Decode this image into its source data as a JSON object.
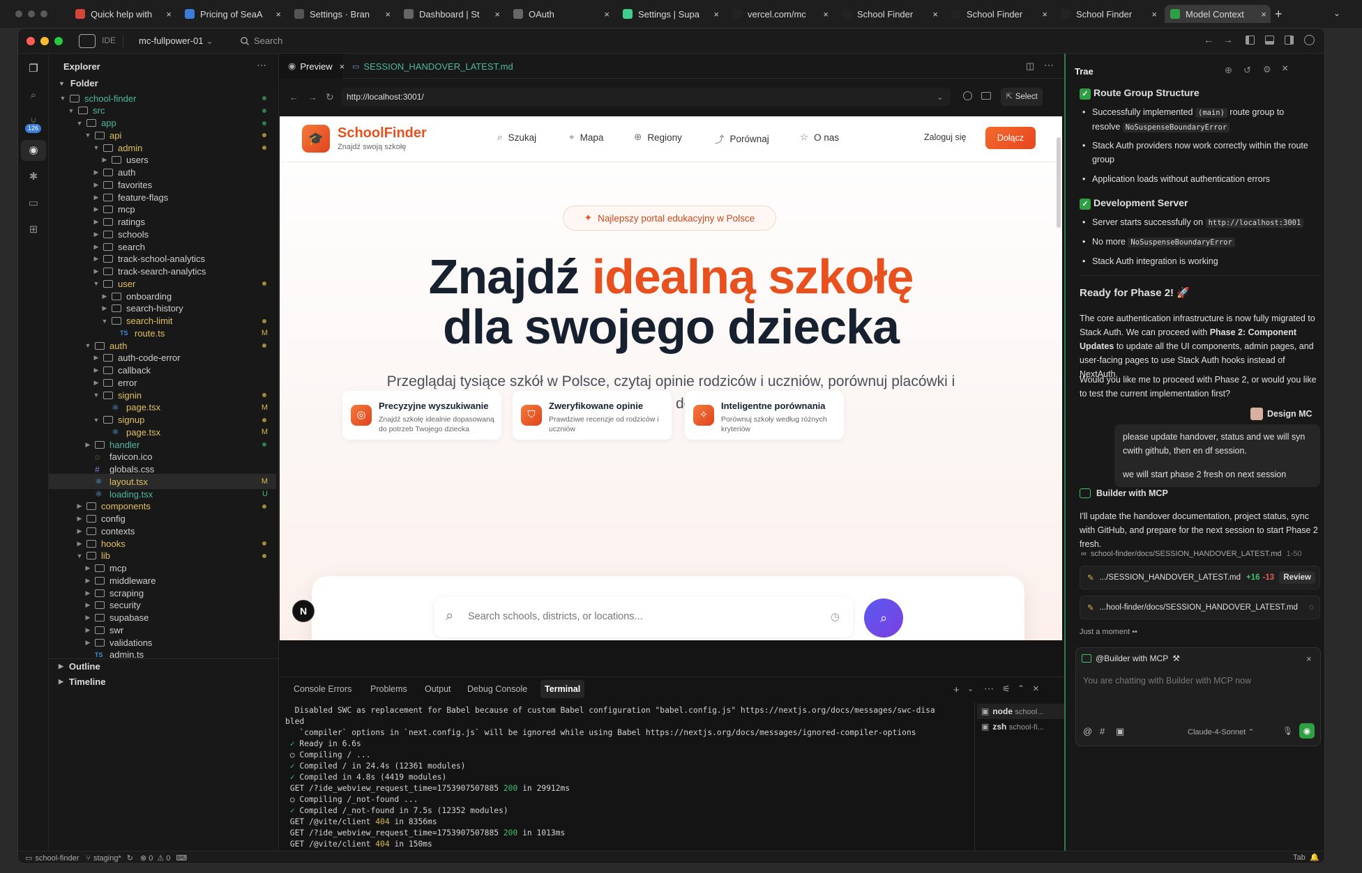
{
  "browser_tabs": [
    {
      "label": "Quick help with",
      "icon": "gmail-icon"
    },
    {
      "label": "Pricing of SeaA",
      "icon": "globe-icon"
    },
    {
      "label": "Settings · Bran",
      "icon": "github-icon"
    },
    {
      "label": "Dashboard | St",
      "icon": "stack-icon"
    },
    {
      "label": "OAuth",
      "icon": "stack-icon"
    },
    {
      "label": "Settings | Supa",
      "icon": "supabase-icon"
    },
    {
      "label": "vercel.com/mc",
      "icon": "vercel-icon"
    },
    {
      "label": "School Finder",
      "icon": "vercel-icon"
    },
    {
      "label": "School Finder",
      "icon": "vercel-icon"
    },
    {
      "label": "School Finder",
      "icon": "vercel-icon"
    },
    {
      "label": "Model Context",
      "icon": "mcp-icon"
    }
  ],
  "titlebar": {
    "ide_label": "IDE",
    "project": "mc-fullpower-01",
    "search_placeholder": "Search"
  },
  "activity": {
    "badge": "126"
  },
  "explorer": {
    "title": "Explorer",
    "folder_label": "Folder",
    "tree": [
      {
        "label": "school-finder",
        "depth": 0,
        "type": "folder",
        "open": true,
        "color": "#4fb8a0",
        "dot": "#2e7d4f"
      },
      {
        "label": "src",
        "depth": 1,
        "type": "folder",
        "open": true,
        "color": "#4fb8a0",
        "dot": "#2e7d4f"
      },
      {
        "label": "app",
        "depth": 2,
        "type": "folder",
        "open": true,
        "color": "#4fb8a0",
        "dot": "#2e7d4f"
      },
      {
        "label": "api",
        "depth": 3,
        "type": "folder",
        "open": true,
        "color": "#e0c060",
        "dot": "#a08a3a"
      },
      {
        "label": "admin",
        "depth": 4,
        "type": "folder",
        "open": true,
        "color": "#e0c060",
        "dot": "#a08a3a"
      },
      {
        "label": "users",
        "depth": 5,
        "type": "folder",
        "open": false,
        "color": "#cfcfcf"
      },
      {
        "label": "auth",
        "depth": 4,
        "type": "folder",
        "open": false,
        "color": "#cfcfcf"
      },
      {
        "label": "favorites",
        "depth": 4,
        "type": "folder",
        "open": false,
        "color": "#cfcfcf"
      },
      {
        "label": "feature-flags",
        "depth": 4,
        "type": "folder",
        "open": false,
        "color": "#cfcfcf"
      },
      {
        "label": "mcp",
        "depth": 4,
        "type": "folder",
        "open": false,
        "color": "#cfcfcf"
      },
      {
        "label": "ratings",
        "depth": 4,
        "type": "folder",
        "open": false,
        "color": "#cfcfcf"
      },
      {
        "label": "schools",
        "depth": 4,
        "type": "folder",
        "open": false,
        "color": "#cfcfcf"
      },
      {
        "label": "search",
        "depth": 4,
        "type": "folder",
        "open": false,
        "color": "#cfcfcf"
      },
      {
        "label": "track-school-analytics",
        "depth": 4,
        "type": "folder",
        "open": false,
        "color": "#cfcfcf"
      },
      {
        "label": "track-search-analytics",
        "depth": 4,
        "type": "folder",
        "open": false,
        "color": "#cfcfcf"
      },
      {
        "label": "user",
        "depth": 4,
        "type": "folder",
        "open": true,
        "color": "#e0c060",
        "dot": "#a08a3a"
      },
      {
        "label": "onboarding",
        "depth": 5,
        "type": "folder",
        "open": false,
        "color": "#cfcfcf"
      },
      {
        "label": "search-history",
        "depth": 5,
        "type": "folder",
        "open": false,
        "color": "#cfcfcf"
      },
      {
        "label": "search-limit",
        "depth": 5,
        "type": "folder",
        "open": true,
        "color": "#e0c060",
        "dot": "#a08a3a"
      },
      {
        "label": "route.ts",
        "depth": 6,
        "type": "ts",
        "color": "#e0c060",
        "status": "M"
      },
      {
        "label": "auth",
        "depth": 3,
        "type": "folder",
        "open": true,
        "color": "#e0c060",
        "dot": "#a08a3a"
      },
      {
        "label": "auth-code-error",
        "depth": 4,
        "type": "folder",
        "open": false,
        "color": "#cfcfcf"
      },
      {
        "label": "callback",
        "depth": 4,
        "type": "folder",
        "open": false,
        "color": "#cfcfcf"
      },
      {
        "label": "error",
        "depth": 4,
        "type": "folder",
        "open": false,
        "color": "#cfcfcf"
      },
      {
        "label": "signin",
        "depth": 4,
        "type": "folder",
        "open": true,
        "color": "#e0c060",
        "dot": "#a08a3a"
      },
      {
        "label": "page.tsx",
        "depth": 5,
        "type": "tsx",
        "color": "#e0c060",
        "status": "M"
      },
      {
        "label": "signup",
        "depth": 4,
        "type": "folder",
        "open": true,
        "color": "#e0c060",
        "dot": "#a08a3a"
      },
      {
        "label": "page.tsx",
        "depth": 5,
        "type": "tsx",
        "color": "#e0c060",
        "status": "M"
      },
      {
        "label": "handler",
        "depth": 3,
        "type": "folder",
        "open": false,
        "color": "#4fb8a0",
        "dot": "#2e7d4f"
      },
      {
        "label": "favicon.ico",
        "depth": 3,
        "type": "ico",
        "color": "#cfcfcf"
      },
      {
        "label": "globals.css",
        "depth": 3,
        "type": "css",
        "color": "#cfcfcf"
      },
      {
        "label": "layout.tsx",
        "depth": 3,
        "type": "tsx",
        "color": "#e0c060",
        "status": "M",
        "selected": true
      },
      {
        "label": "loading.tsx",
        "depth": 3,
        "type": "tsx",
        "color": "#4fb8a0",
        "status": "U"
      },
      {
        "label": "components",
        "depth": 2,
        "type": "folder",
        "open": false,
        "color": "#e0c060",
        "dot": "#a08a3a"
      },
      {
        "label": "config",
        "depth": 2,
        "type": "folder",
        "open": false,
        "color": "#cfcfcf"
      },
      {
        "label": "contexts",
        "depth": 2,
        "type": "folder",
        "open": false,
        "color": "#cfcfcf"
      },
      {
        "label": "hooks",
        "depth": 2,
        "type": "folder",
        "open": false,
        "color": "#e0c060",
        "dot": "#a08a3a"
      },
      {
        "label": "lib",
        "depth": 2,
        "type": "folder",
        "open": true,
        "color": "#e0c060",
        "dot": "#a08a3a"
      },
      {
        "label": "mcp",
        "depth": 3,
        "type": "folder",
        "open": false,
        "color": "#cfcfcf"
      },
      {
        "label": "middleware",
        "depth": 3,
        "type": "folder",
        "open": false,
        "color": "#cfcfcf"
      },
      {
        "label": "scraping",
        "depth": 3,
        "type": "folder",
        "open": false,
        "color": "#cfcfcf"
      },
      {
        "label": "security",
        "depth": 3,
        "type": "folder",
        "open": false,
        "color": "#cfcfcf"
      },
      {
        "label": "supabase",
        "depth": 3,
        "type": "folder",
        "open": false,
        "color": "#cfcfcf"
      },
      {
        "label": "swr",
        "depth": 3,
        "type": "folder",
        "open": false,
        "color": "#cfcfcf"
      },
      {
        "label": "validations",
        "depth": 3,
        "type": "folder",
        "open": false,
        "color": "#cfcfcf"
      },
      {
        "label": "admin.ts",
        "depth": 3,
        "type": "ts",
        "color": "#cfcfcf"
      }
    ],
    "outline": "Outline",
    "timeline": "Timeline"
  },
  "editor_tabs": [
    {
      "label": "Preview",
      "active": true
    },
    {
      "label": "SESSION_HANDOVER_LATEST.md",
      "active": false
    }
  ],
  "preview_toolbar": {
    "url": "http://localhost:3001/",
    "select_label": "Select"
  },
  "site": {
    "brand": "SchoolFinder",
    "tagline": "Znajdź swoją szkołę",
    "nav": [
      "Szukaj",
      "Mapa",
      "Regiony",
      "Porównaj",
      "O nas"
    ],
    "login": "Zaloguj się",
    "join": "Dołącz",
    "badge": "Najlepszy portal edukacyjny w Polsce",
    "hero_1": "Znajdź ",
    "hero_accent": "idealną szkołę",
    "hero_2": "dla swojego dziecka",
    "subtitle_1": "Przeglądaj tysiące szkół w Polsce, czytaj opinie rodziców i uczniów, porównuj placówki i",
    "subtitle_2": "podejmuj świadome decyzje o edukacji.",
    "features": [
      {
        "title": "Precyzyjne wyszukiwanie",
        "desc_1": "Znajdź szkołę idealnie dopasowaną",
        "desc_2": "do potrzeb Twojego dziecka"
      },
      {
        "title": "Zweryfikowane opinie",
        "desc_1": "Prawdziwe recenzje od rodziców i",
        "desc_2": "uczniów"
      },
      {
        "title": "Inteligentne porównania",
        "desc_1": "Porównuj szkoły według różnych",
        "desc_2": "kryteriów"
      }
    ],
    "search_placeholder": "Search schools, districts, or locations...",
    "next_badge": "N",
    "accent": "#e8501e"
  },
  "panel_tabs": [
    "Console Errors",
    "Problems",
    "Output",
    "Debug Console",
    "Terminal"
  ],
  "terminal": {
    "lines": [
      {
        "text": "  Disabled SWC as replacement for Babel because of custom Babel configuration \"babel.config.js\" https://nextjs.org/docs/messages/swc-disa"
      },
      {
        "text": "bled"
      },
      {
        "text": "   `compiler` options in `next.config.js` will be ignored while using Babel https://nextjs.org/docs/messages/ignored-compiler-options"
      },
      {
        "text": " ✓ Ready in 6.6s"
      },
      {
        "text": " ○ Compiling / ..."
      },
      {
        "text": " ✓ Compiled / in 24.4s (12361 modules)"
      },
      {
        "text": " ✓ Compiled in 4.8s (4419 modules)"
      },
      {
        "text": " GET /?ide_webview_request_time=1753907507885 200 in 29912ms"
      },
      {
        "text": " ○ Compiling /_not-found ..."
      },
      {
        "text": " ✓ Compiled /_not-found in 7.5s (12352 modules)"
      },
      {
        "text": " GET /@vite/client 404 in 8356ms"
      },
      {
        "text": " GET /?ide_webview_request_time=1753907507885 200 in 1013ms"
      },
      {
        "text": " GET /@vite/client 404 in 150ms"
      }
    ],
    "sessions": [
      {
        "name": "node",
        "detail": "school..."
      },
      {
        "name": "zsh",
        "detail": "school-fi..."
      }
    ]
  },
  "chat": {
    "title": "Trae",
    "h_route": "Route Group Structure",
    "route_b1_a": "Successfully implemented",
    "route_b1_code": "(main)",
    "route_b1_b": "route group to",
    "route_b1_c": "resolve",
    "route_b1_code2": "NoSuspenseBoundaryError",
    "route_b2": "Stack Auth providers now work correctly within the route group",
    "route_b3": "Application loads without authentication errors",
    "h_dev": "Development Server",
    "dev_b1": "Server starts successfully on",
    "dev_b1_code": "http://localhost:3001",
    "dev_b2": "No more",
    "dev_b2_code": "NoSuspenseBoundaryError",
    "dev_b3": "Stack Auth integration is working",
    "ready": "Ready for Phase 2! 🚀",
    "para1_a": "The core authentication infrastructure is now fully migrated to Stack Auth. We can proceed with",
    "para1_bold": "Phase 2: Component Updates",
    "para1_b": "to update all the UI components, admin pages, and user-facing pages to use Stack Auth hooks instead of NextAuth.",
    "para2": "Would you like me to proceed with Phase 2, or would you like to test the current implementation first?",
    "user_name": "Design MC",
    "user_msg_1": "please update handover, status and we will syn cwith github, then en df session.",
    "user_msg_2": "we will start phase 2 fresh on next session",
    "agent_name": "Builder with MCP",
    "agent_msg": "I'll update the handover documentation, project status, sync with GitHub, and prepare for the next session to start Phase 2 fresh.",
    "file_ref": "school-finder/docs/SESSION_HANDOVER_LATEST.md",
    "file_range": "1-50",
    "edit1_file": ".../SESSION_HANDOVER_LATEST.md",
    "edit1_add": "+16",
    "edit1_del": "-13",
    "review": "Review",
    "edit2_file": "...hool-finder/docs/SESSION_HANDOVER_LATEST.md",
    "status": "Just a moment",
    "mention": "@Builder with MCP",
    "input_placeholder": "You are chatting with Builder with MCP now",
    "model": "Claude-4-Sonnet"
  },
  "statusbar": {
    "repo": "school-finder",
    "branch": "staging*",
    "errors": "0",
    "warnings": "0",
    "tab": "Tab"
  },
  "colors": {
    "accent_green": "#2e7d4f",
    "term_green": "#3fbf6f",
    "term_yellow": "#d7b84a"
  }
}
